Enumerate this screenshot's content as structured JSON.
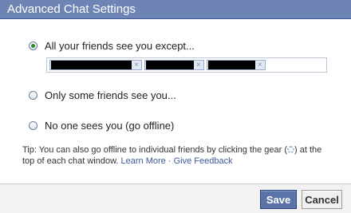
{
  "dialog": {
    "title": "Advanced Chat Settings"
  },
  "options": [
    {
      "label": "All your friends see you except...",
      "selected": true
    },
    {
      "label": "Only some friends see you...",
      "selected": false
    },
    {
      "label": "No one sees you (go offline)",
      "selected": false
    }
  ],
  "tokens": [
    {
      "remove_icon": "×",
      "redacted": true
    },
    {
      "remove_icon": "×",
      "redacted": true
    },
    {
      "remove_icon": "×",
      "redacted": true
    }
  ],
  "tip": {
    "text_before": "Tip: You can also go offline to individual friends by clicking the gear (",
    "text_after": ") at the top of each chat window.",
    "learn_more": "Learn More",
    "separator": "·",
    "give_feedback": "Give Feedback",
    "icon": "gear-icon"
  },
  "footer": {
    "save_label": "Save",
    "cancel_label": "Cancel"
  },
  "colors": {
    "title_bar": "#6d84b4",
    "link": "#3b5998",
    "save_button": "#5b74a8",
    "selected_radio": "#2a8a2e"
  }
}
